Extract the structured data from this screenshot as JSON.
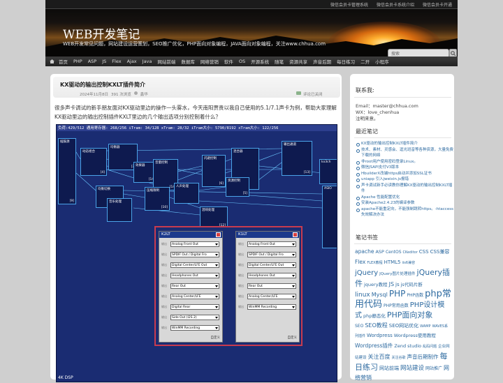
{
  "top_links": [
    "微信会员卡管理系统",
    "微信会员卡系统介绍",
    "微信会员卡开通"
  ],
  "site": {
    "title": "WEB开发笔记",
    "description": "WEB开发常见问题，网站建设运营策划，SEO推广优化，PHP面向对象编程，JAVA面向对象编程，关注www.chhua.com"
  },
  "search": {
    "placeholder": "搜索"
  },
  "nav": [
    "首页",
    "PHP",
    "ASP",
    "JS",
    "Flex",
    "Ajax",
    "Java",
    "网站前端",
    "数据库",
    "网络营销",
    "软件",
    "OS",
    "开源系统",
    "随笔",
    "资源共享",
    "声音后期",
    "每日练习",
    "二开",
    "小程序"
  ],
  "post": {
    "title": "KX驱动的输出控制KXLT插件简介",
    "date": "2024年11月8日",
    "views": "391 次浏览",
    "author": "鑫华",
    "comments": "评论已关闭",
    "body": "很多声卡调试的新手朋友面对KX驱动里边的操作一头雾水，今天南阳贾贵以我自己使用的5.1/7.1声卡为例，帮助大家理解KX驱动里边的输出控制插件KXLT里边的几个输出选项分别控制着什么？"
  },
  "figure": {
    "status": "负荷:429/512 通用寄存器: 268/256 iTram: 34/128 xTram: 28/32 iTram大小: 5790/8192 xTram大小: 122/256",
    "blocks": [
      {
        "label": "插鼓源",
        "tag": "[9]"
      },
      {
        "label": "动态组合",
        "tag": "[4]"
      },
      {
        "label": "均衡器",
        "tag": "[3]"
      },
      {
        "label": "效果器",
        "tag": "[14]"
      },
      {
        "label": "音量控制",
        "tag": "[14]"
      },
      {
        "label": "闪避控制",
        "tag": "[6]"
      },
      {
        "label": "混合器",
        "tag": ""
      },
      {
        "label": "输出通道",
        "tag": "[13]"
      },
      {
        "label": "kx3ch",
        "tag": ""
      },
      {
        "label": "均衡切换",
        "tag": "[9]"
      },
      {
        "label": "压缩限制",
        "tag": "[10]"
      },
      {
        "label": "人声处理",
        "tag": ""
      },
      {
        "label": "音乐处理",
        "tag": ""
      },
      {
        "label": "资源控制",
        "tag": "[5]"
      },
      {
        "label": "ASIO",
        "tag": ""
      },
      {
        "label": "混响处理",
        "tag": "[12]"
      }
    ],
    "dialogs": [
      {
        "title": "K2LT",
        "rows": [
          "Analog Front Out",
          "SPDIF Out / Digital Fro",
          "Digital Center/LFE Out",
          "Headphones Out",
          "Rear Out",
          "Analog Center/LFE",
          "Digital Rear",
          "Side Out (I2S 2)",
          "WinMM Recording"
        ],
        "footer": "自定义"
      },
      {
        "title": "K1LT",
        "rows": [
          "Analog Front Out",
          "SPDIF Out / Digital Fro",
          "Digital Center/LFE Out",
          "Headphones Out",
          "Rear Out",
          "Analog Center/LFE",
          "WinMM Recording"
        ],
        "footer": "自定义"
      }
    ],
    "row_label": "输出",
    "footer": "4K DSP"
  },
  "sidebar": {
    "contact_title": "联系我:",
    "email": "Email：master@chhua.com",
    "wx": "WX：love_chenhua",
    "note": "注明来意。",
    "recent_title": "最近笔记",
    "recent": [
      "KX驱动的输出控制KXLT插件简介",
      "技术、素材、灵感会、逗光班音等各种资源，大量免费下载的网络",
      "非root用户使用密码登录Linux。",
      "微信JSAPI支付V3版本",
      "HbuilderX改端https启动并添加SSL证书",
      "uniapp 引入jweixin.js报错",
      "声卡调试新手必读教你理解KX驱动的输出控制KXLT插件",
      "Apache 性能配置优化",
      "安装Apache2.4.23的编译参数",
      "apache不能重定向，不能强制跳转https。-htaccess失效解决办法"
    ],
    "tags_title": "笔记书签",
    "tags": [
      {
        "t": "apache",
        "s": 7.5
      },
      {
        "t": "ASP",
        "s": 6.5
      },
      {
        "t": "CentOS",
        "s": 6
      },
      {
        "t": "CKeditor",
        "s": 5
      },
      {
        "t": "CSS",
        "s": 7
      },
      {
        "t": "CSS兼容",
        "s": 7
      },
      {
        "t": "Flex",
        "s": 7.5
      },
      {
        "t": "FLEX教程",
        "s": 5
      },
      {
        "t": "HTML5",
        "s": 7
      },
      {
        "t": "iis6兼容",
        "s": 5
      },
      {
        "t": "jQuery",
        "s": 10
      },
      {
        "t": "JQuery图片处理插件",
        "s": 5.5
      },
      {
        "t": "jQuery插件",
        "s": 11
      },
      {
        "t": "jquery教程",
        "s": 6.5
      },
      {
        "t": "JS",
        "s": 8
      },
      {
        "t": "js",
        "s": 7
      },
      {
        "t": "js代码片断",
        "s": 6.5
      },
      {
        "t": "linux",
        "s": 9
      },
      {
        "t": "Mysql",
        "s": 8
      },
      {
        "t": "PHP",
        "s": 12
      },
      {
        "t": "PHP函数",
        "s": 6
      },
      {
        "t": "php常用代码",
        "s": 13
      },
      {
        "t": "PHP常用函数",
        "s": 6
      },
      {
        "t": "PHP设计模式",
        "s": 10
      },
      {
        "t": "php静态化",
        "s": 6.5
      },
      {
        "t": "PHP面向对象",
        "s": 11
      },
      {
        "t": "SEO",
        "s": 6
      },
      {
        "t": "SEO教程",
        "s": 8
      },
      {
        "t": "SEO网站优化",
        "s": 7
      },
      {
        "t": "WAMP",
        "s": 5
      },
      {
        "t": "WAVES系列插件",
        "s": 5
      },
      {
        "t": "Wordpress",
        "s": 7
      },
      {
        "t": "Wordpress使用教程",
        "s": 6.5
      },
      {
        "t": "Wordpress插件",
        "s": 7.5
      },
      {
        "t": "Zend studio",
        "s": 6.5
      },
      {
        "t": "乱码问题",
        "s": 5
      },
      {
        "t": "企业网站建设",
        "s": 5.5
      },
      {
        "t": "关注百度",
        "s": 8
      },
      {
        "t": "关注谷歌",
        "s": 5
      },
      {
        "t": "声音后期制作",
        "s": 7.5
      },
      {
        "t": "每日练习",
        "s": 11
      },
      {
        "t": "网站前端",
        "s": 7
      },
      {
        "t": "网站建设",
        "s": 8.5
      },
      {
        "t": "网站推广",
        "s": 6
      },
      {
        "t": "网络营销",
        "s": 8
      }
    ]
  },
  "colors": {
    "link": "#2d6aa0",
    "nav_bg": "#2a2a2a",
    "figure_bg": "#1a2c72"
  }
}
